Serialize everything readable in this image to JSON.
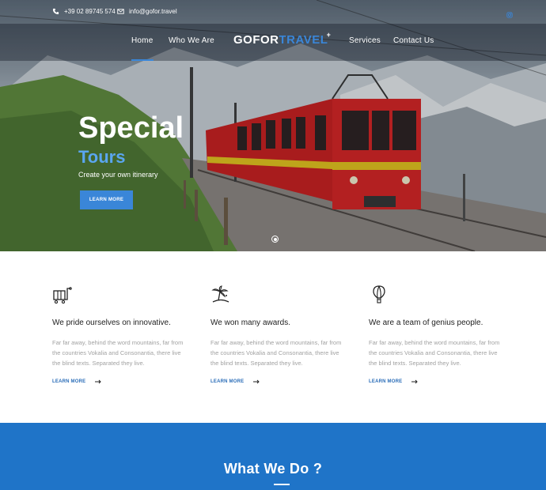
{
  "topbar": {
    "phone": "+39 02 89745 574",
    "email": "info@gofor.travel",
    "icons": [
      "phone-icon",
      "mail-icon",
      "instagram-icon"
    ]
  },
  "nav": {
    "home": "Home",
    "who": "Who We Are",
    "logo_left": "GOFOR",
    "logo_right": "TRAVEL",
    "logo_plus": "+",
    "services": "Services",
    "contact": "Contact Us"
  },
  "hero": {
    "title": "Special",
    "subtitle": "Tours",
    "description": "Create your own itinerary",
    "button": "LEARN MORE"
  },
  "features": [
    {
      "icon": "luggage-cart-icon",
      "title": "We pride ourselves on innovative.",
      "body": "Far far away, behind the word mountains, far from the countries Vokalia and Consonantia, there live the blind texts. Separated they live.",
      "link": "LEARN MORE"
    },
    {
      "icon": "island-palm-icon",
      "title": "We won many awards.",
      "body": "Far far away, behind the word mountains, far from the countries Vokalia and Consonantia, there live the blind texts. Separated they live.",
      "link": "LEARN MORE"
    },
    {
      "icon": "hot-air-balloon-icon",
      "title": "We are a team of genius people.",
      "body": "Far far away, behind the word mountains, far from the countries Vokalia and Consonantia, there live the blind texts. Separated they live.",
      "link": "LEARN MORE"
    }
  ],
  "section": {
    "title": "What We Do ?"
  },
  "colors": {
    "accent": "#3a86d8",
    "section_bg": "#1f74c8",
    "train_red": "#d21f1f"
  }
}
